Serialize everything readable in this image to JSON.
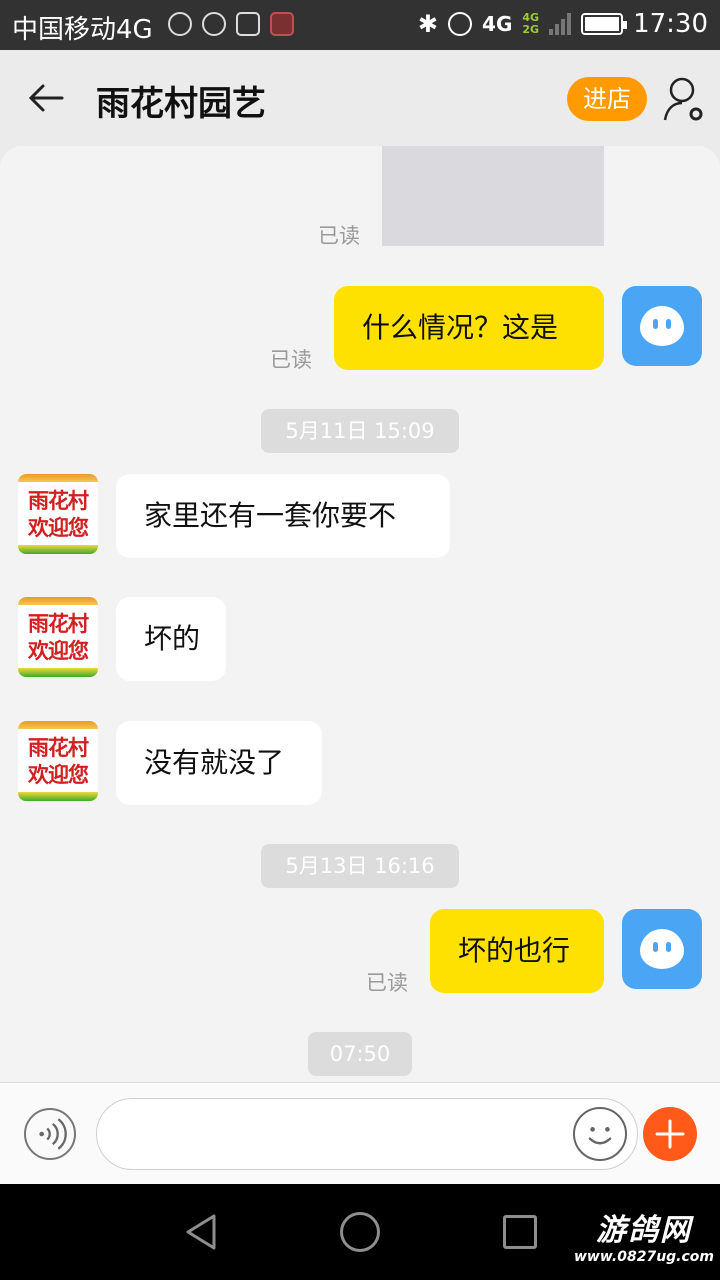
{
  "status_bar": {
    "carrier": "中国移动4G",
    "network": "4G",
    "network_secondary": [
      "4G",
      "2G"
    ],
    "battery_level": 1.0,
    "time": "17:30",
    "icons": [
      "wifi-heart-icon",
      "chat-bubble-icon",
      "image-icon",
      "app-icon",
      "bluetooth-icon",
      "alarm-icon",
      "signal-icon",
      "battery-icon"
    ]
  },
  "header": {
    "title": "雨花村园艺",
    "store_button": "进店",
    "store_button_color": "#ff9a00"
  },
  "chat": {
    "messages": [
      {
        "type": "image",
        "from": "me",
        "read_label": "已读"
      },
      {
        "type": "text",
        "from": "me",
        "text": "什么情况？这是",
        "read_label": "已读"
      },
      {
        "type": "time",
        "text": "5月11日 15:09"
      },
      {
        "type": "text",
        "from": "them",
        "text": "家里还有一套你要不"
      },
      {
        "type": "text",
        "from": "them",
        "text": "坏的"
      },
      {
        "type": "text",
        "from": "them",
        "text": "没有就没了"
      },
      {
        "type": "time",
        "text": "5月13日 16:16"
      },
      {
        "type": "text",
        "from": "me",
        "text": "坏的也行",
        "read_label": "已读"
      },
      {
        "type": "time",
        "text": "07:50"
      }
    ],
    "shop_avatar_text": [
      "雨花村",
      "欢迎您"
    ],
    "my_bubble_color": "#ffe100",
    "my_avatar_color": "#4aa6f4"
  },
  "input_bar": {
    "value": "",
    "plus_button_color": "#ff5a1a"
  },
  "watermark": {
    "line1": "游鸽网",
    "line2": "www.0827ug.com"
  }
}
